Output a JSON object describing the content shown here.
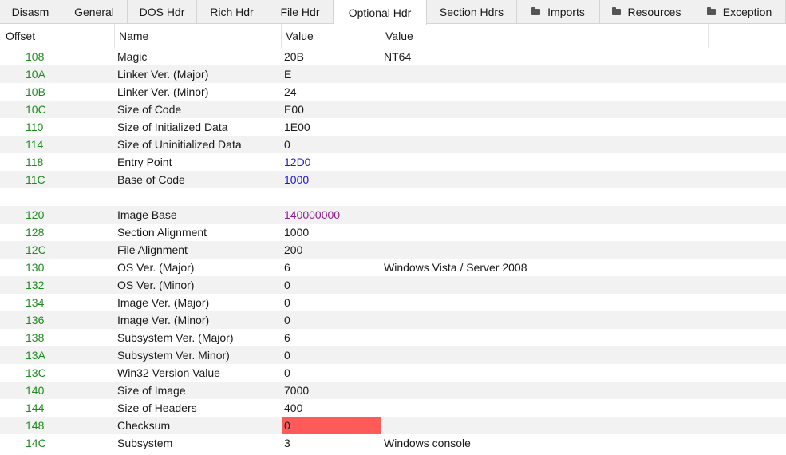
{
  "tabs": [
    {
      "label": "Disasm",
      "folder": false,
      "active": false
    },
    {
      "label": "General",
      "folder": false,
      "active": false
    },
    {
      "label": "DOS Hdr",
      "folder": false,
      "active": false
    },
    {
      "label": "Rich Hdr",
      "folder": false,
      "active": false
    },
    {
      "label": "File Hdr",
      "folder": false,
      "active": false
    },
    {
      "label": "Optional Hdr",
      "folder": false,
      "active": true
    },
    {
      "label": "Section Hdrs",
      "folder": false,
      "active": false
    },
    {
      "label": "Imports",
      "folder": true,
      "active": false
    },
    {
      "label": "Resources",
      "folder": true,
      "active": false
    },
    {
      "label": "Exception",
      "folder": true,
      "active": false
    }
  ],
  "columns": {
    "offset": "Offset",
    "name": "Name",
    "value": "Value",
    "value2": "Value"
  },
  "colors": {
    "offset_text": "#1e8c1e",
    "address_value": "#1a1ad0",
    "image_base_value": "#8c1e8c",
    "checksum_highlight": "#ff5a5a",
    "alt_row": "#f2f2f2"
  },
  "rows": [
    {
      "offset": "108",
      "name": "Magic",
      "value": "20B",
      "value2": "NT64",
      "style": ""
    },
    {
      "offset": "10A",
      "name": "Linker Ver. (Major)",
      "value": "E",
      "value2": "",
      "style": ""
    },
    {
      "offset": "10B",
      "name": "Linker Ver. (Minor)",
      "value": "24",
      "value2": "",
      "style": ""
    },
    {
      "offset": "10C",
      "name": "Size of Code",
      "value": "E00",
      "value2": "",
      "style": ""
    },
    {
      "offset": "110",
      "name": "Size of Initialized Data",
      "value": "1E00",
      "value2": "",
      "style": ""
    },
    {
      "offset": "114",
      "name": "Size of Uninitialized Data",
      "value": "0",
      "value2": "",
      "style": ""
    },
    {
      "offset": "118",
      "name": "Entry Point",
      "value": "12D0",
      "value2": "",
      "style": "blue"
    },
    {
      "offset": "11C",
      "name": "Base of Code",
      "value": "1000",
      "value2": "",
      "style": "blue"
    },
    {
      "offset": "",
      "name": "",
      "value": "",
      "value2": "",
      "style": ""
    },
    {
      "offset": "120",
      "name": "Image Base",
      "value": "140000000",
      "value2": "",
      "style": "purple"
    },
    {
      "offset": "128",
      "name": "Section Alignment",
      "value": "1000",
      "value2": "",
      "style": ""
    },
    {
      "offset": "12C",
      "name": "File Alignment",
      "value": "200",
      "value2": "",
      "style": ""
    },
    {
      "offset": "130",
      "name": "OS Ver. (Major)",
      "value": "6",
      "value2": "Windows Vista / Server 2008",
      "style": ""
    },
    {
      "offset": "132",
      "name": "OS Ver. (Minor)",
      "value": "0",
      "value2": "",
      "style": ""
    },
    {
      "offset": "134",
      "name": "Image Ver. (Major)",
      "value": "0",
      "value2": "",
      "style": ""
    },
    {
      "offset": "136",
      "name": "Image Ver. (Minor)",
      "value": "0",
      "value2": "",
      "style": ""
    },
    {
      "offset": "138",
      "name": "Subsystem Ver. (Major)",
      "value": "6",
      "value2": "",
      "style": ""
    },
    {
      "offset": "13A",
      "name": "Subsystem Ver. Minor)",
      "value": "0",
      "value2": "",
      "style": ""
    },
    {
      "offset": "13C",
      "name": "Win32 Version Value",
      "value": "0",
      "value2": "",
      "style": ""
    },
    {
      "offset": "140",
      "name": "Size of Image",
      "value": "7000",
      "value2": "",
      "style": ""
    },
    {
      "offset": "144",
      "name": "Size of Headers",
      "value": "400",
      "value2": "",
      "style": ""
    },
    {
      "offset": "148",
      "name": "Checksum",
      "value": "0",
      "value2": "",
      "style": "red"
    },
    {
      "offset": "14C",
      "name": "Subsystem",
      "value": "3",
      "value2": "Windows console",
      "style": ""
    }
  ]
}
